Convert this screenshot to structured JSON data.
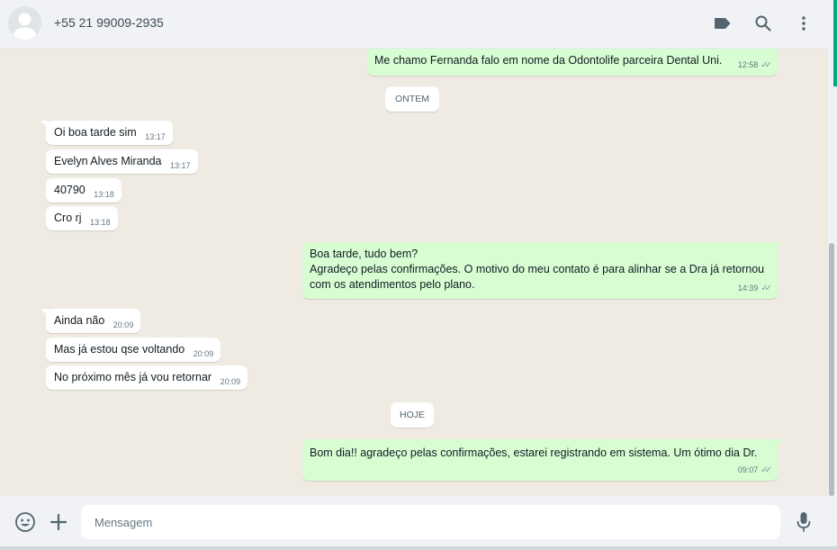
{
  "header": {
    "contact_name": "+55 21 99009-2935",
    "icons": [
      "label-icon",
      "search-icon",
      "menu-icon"
    ]
  },
  "messages": {
    "m0": {
      "text": "Me chamo Fernanda falo em nome da Odontolife parceira Dental Uni.",
      "time": "12:58",
      "direction": "out"
    },
    "chip_ontem": "ONTEM",
    "m1": {
      "text": "Oi boa tarde sim",
      "time": "13:17",
      "direction": "in"
    },
    "m2": {
      "text": "Evelyn Alves Miranda",
      "time": "13:17",
      "direction": "in"
    },
    "m3": {
      "text": "40790",
      "time": "13:18",
      "direction": "in"
    },
    "m4": {
      "text": "Cro rj",
      "time": "13:18",
      "direction": "in"
    },
    "m5": {
      "line1": "Boa tarde, tudo bem?",
      "line2": "Agradeço pelas confirmações. O motivo do meu contato é para alinhar se a Dra já retornou",
      "line3": "com os atendimentos pelo plano.",
      "time": "14:39",
      "direction": "out"
    },
    "m6": {
      "text": "Ainda não",
      "time": "20:09",
      "direction": "in"
    },
    "m7": {
      "text": "Mas já estou qse voltando",
      "time": "20:09",
      "direction": "in"
    },
    "m8": {
      "text": "No próximo mês já vou retornar",
      "time": "20:09",
      "direction": "in"
    },
    "chip_hoje": "HOJE",
    "m9": {
      "text": "Bom dia!! agradeço pelas confirmações, estarei registrando em sistema. Um ótimo dia Dr.",
      "time": "09:07",
      "direction": "out"
    }
  },
  "footer": {
    "placeholder": "Mensagem",
    "icons": [
      "emoji-icon",
      "plus-icon",
      "mic-icon"
    ]
  },
  "colors": {
    "chat_bg": "#efeae2",
    "outgoing_bubble": "#d9fdd3",
    "incoming_bubble": "#ffffff",
    "header_bg": "#f0f2f5",
    "accent": "#00a884"
  }
}
